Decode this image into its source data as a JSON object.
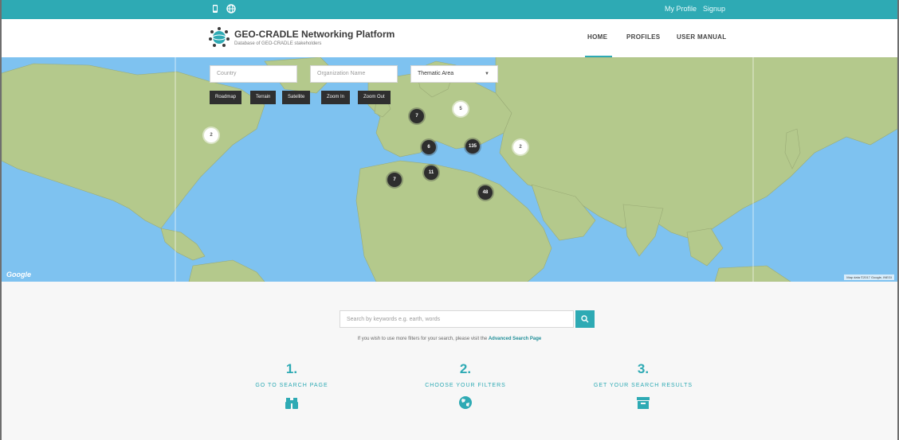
{
  "topbar": {
    "icons": [
      "mobile-icon",
      "globe-icon"
    ],
    "my_profile": "My Profile",
    "signup": "Signup"
  },
  "header": {
    "title": "GEO-CRADLE Networking Platform",
    "subtitle": "Database of GEO-CRADLE stakeholders",
    "nav": [
      "HOME",
      "PROFILES",
      "USER MANUAL"
    ],
    "active_nav": "HOME"
  },
  "map": {
    "country_placeholder": "Country",
    "org_placeholder": "Organization Name",
    "thematic_area": "Thematic Area",
    "buttons": [
      "Roadmap",
      "Terrain",
      "Satellite",
      "Zoom In",
      "Zoom Out"
    ],
    "clusters": [
      {
        "label": "2",
        "style": "light"
      },
      {
        "label": "5",
        "style": "light"
      },
      {
        "label": "7",
        "style": "dark"
      },
      {
        "label": "6",
        "style": "dark"
      },
      {
        "label": "135",
        "style": "dark"
      },
      {
        "label": "2",
        "style": "light"
      },
      {
        "label": "11",
        "style": "dark"
      },
      {
        "label": "7",
        "style": "dark"
      },
      {
        "label": "48",
        "style": "dark"
      }
    ],
    "provider": "Google",
    "attribution": "Map data ©2017 Google, INEGI",
    "colors": {
      "water": "#7ec2f0",
      "land": "#b4c98c"
    }
  },
  "search": {
    "placeholder": "Search by keywords e.g. earth, words",
    "hint_text": "If you wish to use more filters for your search, please visit the",
    "hint_link": "Advanced Search Page"
  },
  "steps": [
    {
      "num": "1.",
      "label": "GO TO SEARCH PAGE",
      "icon": "binoculars-icon"
    },
    {
      "num": "2.",
      "label": "CHOOSE YOUR FILTERS",
      "icon": "globe-icon"
    },
    {
      "num": "3.",
      "label": "GET YOUR SEARCH RESULTS",
      "icon": "archive-box-icon"
    }
  ],
  "colors": {
    "accent": "#2eaab4",
    "dark_button": "#2f2f2f"
  }
}
